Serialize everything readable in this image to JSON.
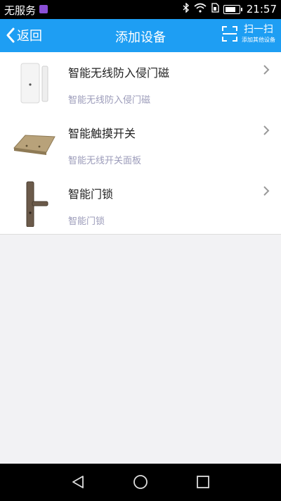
{
  "status_bar": {
    "carrier": "无服务",
    "time": "21:57"
  },
  "header": {
    "back_label": "返回",
    "title": "添加设备",
    "scan_label": "扫一扫",
    "scan_sub": "添加其他设备"
  },
  "devices": [
    {
      "name": "智能无线防入侵门磁",
      "desc": "智能无线防入侵门磁",
      "icon": "door-sensor"
    },
    {
      "name": "智能触摸开关",
      "desc": "智能无线开关面板",
      "icon": "touch-switch"
    },
    {
      "name": "智能门锁",
      "desc": "智能门锁",
      "icon": "door-lock"
    }
  ],
  "colors": {
    "header": "#1e9ef3",
    "desc": "#9c9cba",
    "background": "#f2f2f4"
  }
}
